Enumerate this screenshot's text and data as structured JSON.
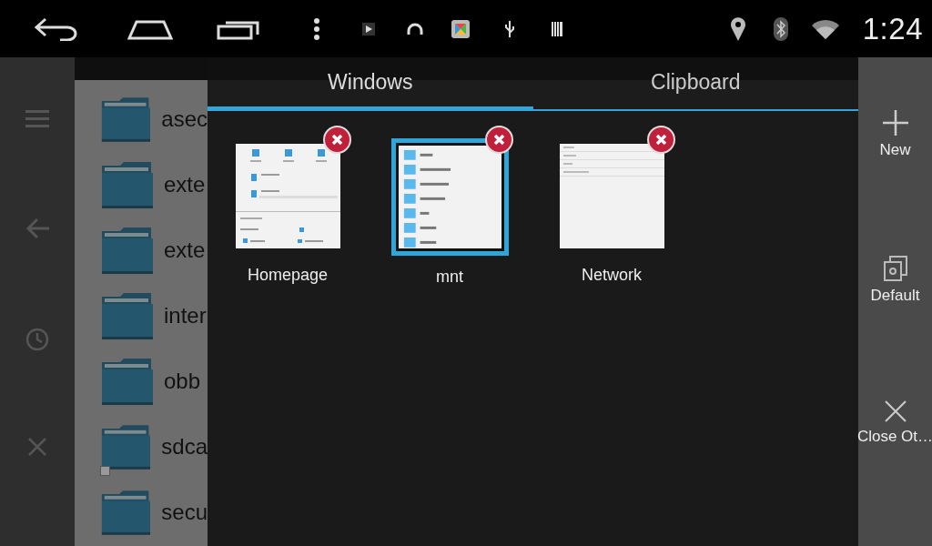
{
  "status_bar": {
    "time": "1:24"
  },
  "background_app": {
    "folders": [
      {
        "name": "asec",
        "shortcut": false
      },
      {
        "name": "exte",
        "shortcut": false
      },
      {
        "name": "exte",
        "shortcut": false
      },
      {
        "name": "inter",
        "shortcut": false
      },
      {
        "name": "obb",
        "shortcut": false
      },
      {
        "name": "sdca",
        "shortcut": true
      },
      {
        "name": "secu",
        "shortcut": false
      }
    ]
  },
  "window_switcher": {
    "tabs": [
      {
        "label": "Windows",
        "selected": true
      },
      {
        "label": "Clipboard",
        "selected": false
      }
    ],
    "windows": [
      {
        "title": "Homepage",
        "selected": false,
        "kind": "home"
      },
      {
        "title": "mnt",
        "selected": true,
        "kind": "list"
      },
      {
        "title": "Network",
        "selected": false,
        "kind": "menu"
      }
    ]
  },
  "actions": [
    {
      "label": "New",
      "kind": "new"
    },
    {
      "label": "Default",
      "kind": "default"
    },
    {
      "label": "Close Ot…",
      "kind": "close"
    }
  ]
}
